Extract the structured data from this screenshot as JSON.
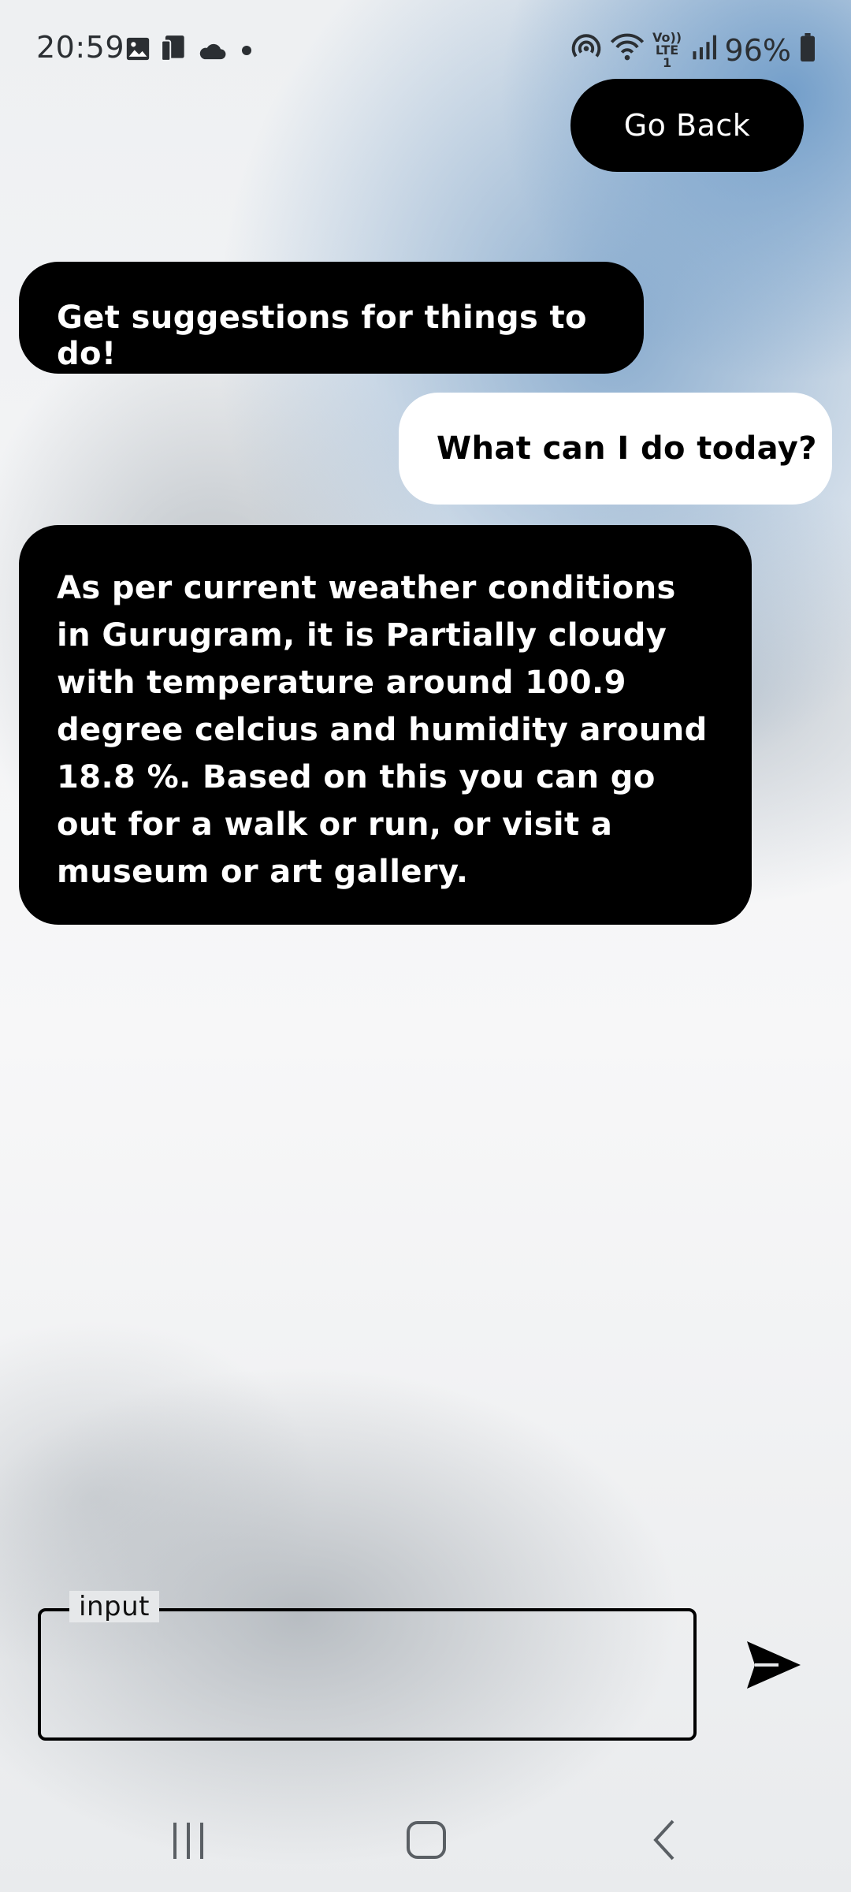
{
  "status_bar": {
    "time": "20:59",
    "battery": "96%",
    "left_icons": [
      "gallery-icon",
      "device-icon",
      "cloud-icon",
      "dot-icon"
    ],
    "right_icons": [
      "hotspot-icon",
      "wifi-icon",
      "volte-lte-icon",
      "signal-icon",
      "battery-icon"
    ],
    "volte_label": "Vo)) LTE1"
  },
  "header": {
    "go_back_label": "Go Back"
  },
  "chat": {
    "messages": [
      {
        "sender": "bot",
        "text": "Get suggestions for things to do!"
      },
      {
        "sender": "user",
        "text": "What can I do today?"
      },
      {
        "sender": "bot",
        "text": "As per current weather conditions in Gurugram, it is Partially cloudy with temperature around 100.9 degree celcius and humidity around 18.8 %. Based on this you can go out for a walk or run, or visit a museum or art gallery."
      }
    ]
  },
  "composer": {
    "input_label": "input",
    "input_value": ""
  },
  "colors": {
    "bubble_bot": "#000000",
    "bubble_user": "#ffffff",
    "accent_blue": "#7fa6cc"
  }
}
